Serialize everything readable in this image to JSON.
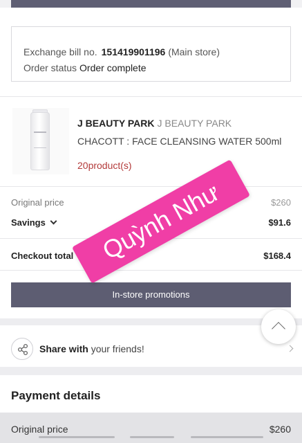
{
  "order": {
    "exchange_label": "Exchange bill no.",
    "exchange_number": "151419901196",
    "exchange_store": "(Main store)",
    "status_label": "Order status",
    "status_value": "Order complete"
  },
  "product": {
    "brand": "J BEAUTY PARK",
    "brand_sub": "J BEAUTY PARK",
    "name": "CHACOTT : FACE CLEANSING WATER 500ml",
    "quantity": "20product(s)",
    "image_icon": "cleansing-water-bottle"
  },
  "pricing": {
    "original_label": "Original price",
    "original_value": "$260",
    "savings_label": "Savings",
    "savings_value": "$91.6",
    "checkout_label": "Checkout total",
    "checkout_value": "$168.4"
  },
  "promotions_button": "In-store promotions",
  "share": {
    "bold": "Share with",
    "rest": "your friends!"
  },
  "payment": {
    "title": "Payment details",
    "original_label": "Original price",
    "original_value": "$260"
  },
  "watermark": "Quỳnh Như",
  "colors": {
    "accent_dark": "#5d5d72",
    "quantity_red": "#b33a3a",
    "watermark_pink": "#f03ea6"
  }
}
